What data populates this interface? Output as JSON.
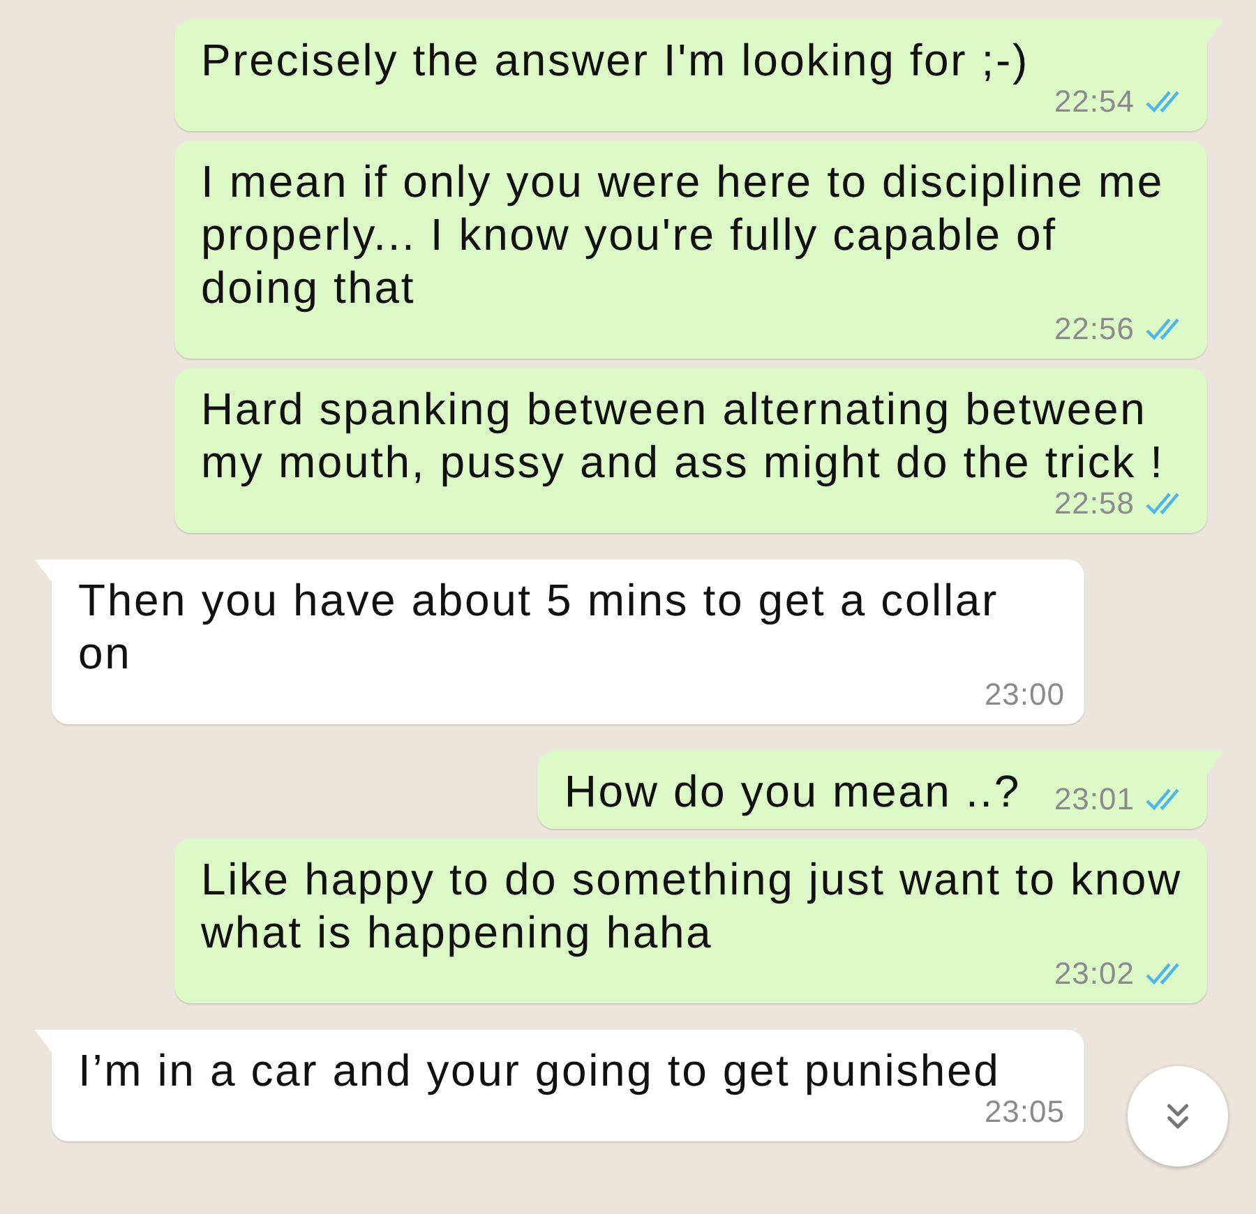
{
  "messages": [
    {
      "kind": "sent",
      "tail": true,
      "text": "Precisely the answer I'm looking for ;-)",
      "time": "22:54",
      "read": true
    },
    {
      "kind": "sent",
      "tail": false,
      "text": "I mean if only you were here to discipline me properly... I know you're fully capable of doing that",
      "time": "22:56",
      "read": true
    },
    {
      "kind": "sent",
      "tail": false,
      "text": "Hard spanking between alternating between my mouth, pussy and ass might do the trick !",
      "time": "22:58",
      "read": true
    },
    {
      "kind": "received",
      "tail": true,
      "text": "Then you have about 5 mins to get a collar on",
      "time": "23:00"
    },
    {
      "kind": "sent",
      "tail": true,
      "text": "How do you mean ..?",
      "time": "23:01",
      "read": true
    },
    {
      "kind": "sent",
      "tail": false,
      "text": "Like happy to do something just want to know what is happening haha",
      "time": "23:02",
      "read": true
    },
    {
      "kind": "received",
      "tail": true,
      "text": "I’m in a car and your going to get punished",
      "time": "23:05"
    }
  ],
  "scroll_button": {
    "kind": "scroll-down"
  }
}
